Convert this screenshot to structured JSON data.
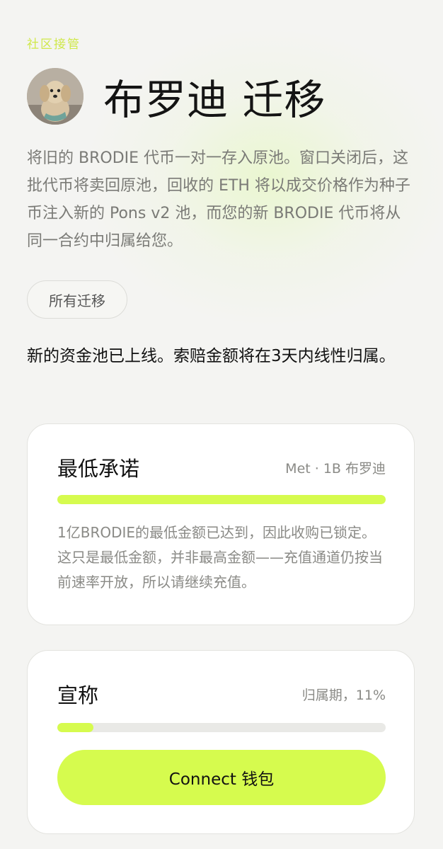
{
  "header": {
    "eyebrow": "社区接管",
    "title": "布罗迪 迁移",
    "description": "将旧的 BRODIE 代币一对一存入原池。窗口关闭后，这批代币将卖回原池，回收的 ETH 将以成交价格作为种子币注入新的 Pons v2 池，而您的新 BRODIE 代币将从同一合约中归属给您。",
    "all_migrations_label": "所有迁移"
  },
  "notice": "新的资金池已上线。索赔金额将在3天内线性归属。",
  "minimum_commitment": {
    "title": "最低承诺",
    "meta": "Met · 1B 布罗迪",
    "progress_fraction": 1.0,
    "body": "1亿BRODIE的最低金额已达到，因此收购已锁定。这只是最低金额，并非最高金额——充值通道仍按当前速率开放，所以请继续充值。"
  },
  "claim": {
    "title": "宣称",
    "meta": "归属期，11%",
    "progress_fraction": 0.11,
    "connect_label": "Connect 钱包"
  },
  "colors": {
    "accent": "#d6fb4e",
    "eyebrow": "#cfe84a",
    "background": "#f4f4f2",
    "track": "#e9e9e6"
  },
  "icons": {
    "avatar": "dog-avatar"
  }
}
